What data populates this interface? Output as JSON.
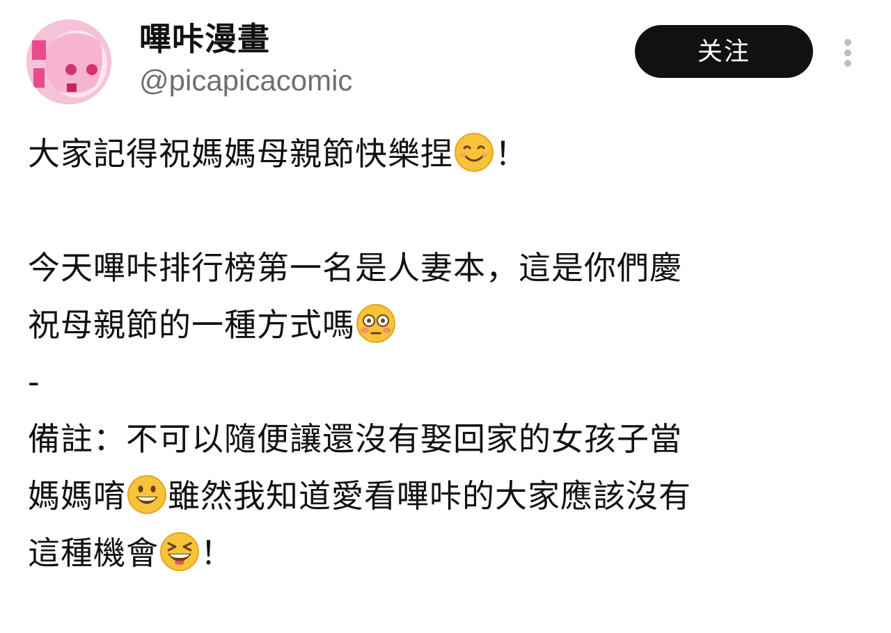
{
  "account": {
    "name": "嗶咔漫畫",
    "handle": "@picapicacomic",
    "avatar_icon": "anime-avatar-icon"
  },
  "actions": {
    "follow_label": "关注",
    "more_icon": "more-vertical-icon"
  },
  "post": {
    "line1": {
      "text": "大家記得祝媽媽母親節快樂捏",
      "emoji": "smiling-face-icon",
      "tail": "！"
    },
    "line2": {
      "text": "今天嗶咔排行榜第一名是人妻本，這是你們慶"
    },
    "line3": {
      "text": "祝母親節的一種方式嗎",
      "emoji": "flushed-face-icon"
    },
    "line4": {
      "text": "-"
    },
    "line5": {
      "text": "備註：不可以隨便讓還沒有娶回家的女孩子當"
    },
    "line6": {
      "text_a": "媽媽唷",
      "emoji": "grinning-face-icon",
      "text_b": "雖然我知道愛看嗶咔的大家應該沒有"
    },
    "line7": {
      "text": "這種機會",
      "emoji": "laughing-face-icon",
      "tail": "！"
    }
  },
  "colors": {
    "button_bg": "#111111",
    "button_text": "#ffffff",
    "handle_text": "#6e6e6e",
    "body_text": "#111111",
    "emoji_yellow": "#f6c33b"
  }
}
